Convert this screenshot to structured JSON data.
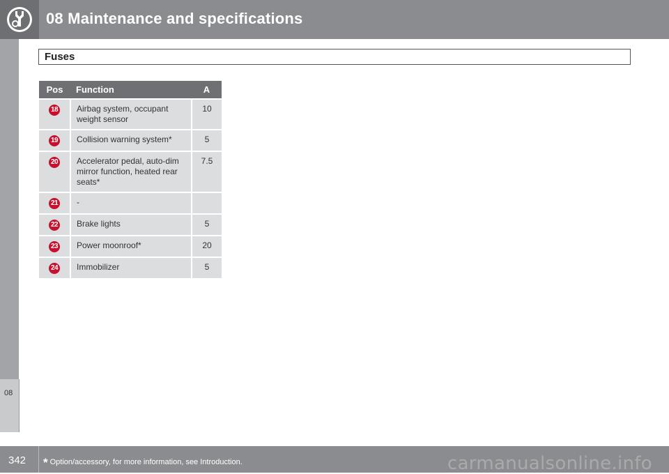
{
  "header": {
    "title": "08 Maintenance and specifications",
    "icon": "wrench-gear-icon"
  },
  "section": {
    "title": "Fuses"
  },
  "side_tab": {
    "label": "08"
  },
  "table": {
    "columns": [
      "Pos",
      "Function",
      "A"
    ],
    "rows": [
      {
        "pos": "18",
        "function": "Airbag system, occupant weight sensor",
        "amperage": "10"
      },
      {
        "pos": "19",
        "function": "Collision warning system*",
        "amperage": "5"
      },
      {
        "pos": "20",
        "function": "Accelerator pedal, auto-dim mirror function, heated rear seats*",
        "amperage": "7.5"
      },
      {
        "pos": "21",
        "function": "-",
        "amperage": ""
      },
      {
        "pos": "22",
        "function": "Brake lights",
        "amperage": "5"
      },
      {
        "pos": "23",
        "function": "Power moonroof*",
        "amperage": "20"
      },
      {
        "pos": "24",
        "function": "Immobilizer",
        "amperage": "5"
      }
    ]
  },
  "footer": {
    "page_number": "342",
    "star": "*",
    "note": "Option/accessory, for more information, see Introduction."
  },
  "watermark": "carmanualsonline.info",
  "colors": {
    "header_bg": "#8b8c8f",
    "table_header_bg": "#6f7073",
    "row_bg": "#dcdddf",
    "badge_red": "#c8102e"
  }
}
